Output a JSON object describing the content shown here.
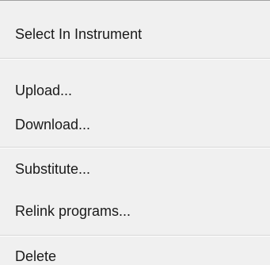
{
  "context_menu": {
    "items": [
      {
        "label": "Select In Instrument"
      },
      {
        "label": "Upload..."
      },
      {
        "label": "Download..."
      },
      {
        "label": "Substitute..."
      },
      {
        "label": "Relink programs..."
      },
      {
        "label": "Delete"
      }
    ]
  }
}
